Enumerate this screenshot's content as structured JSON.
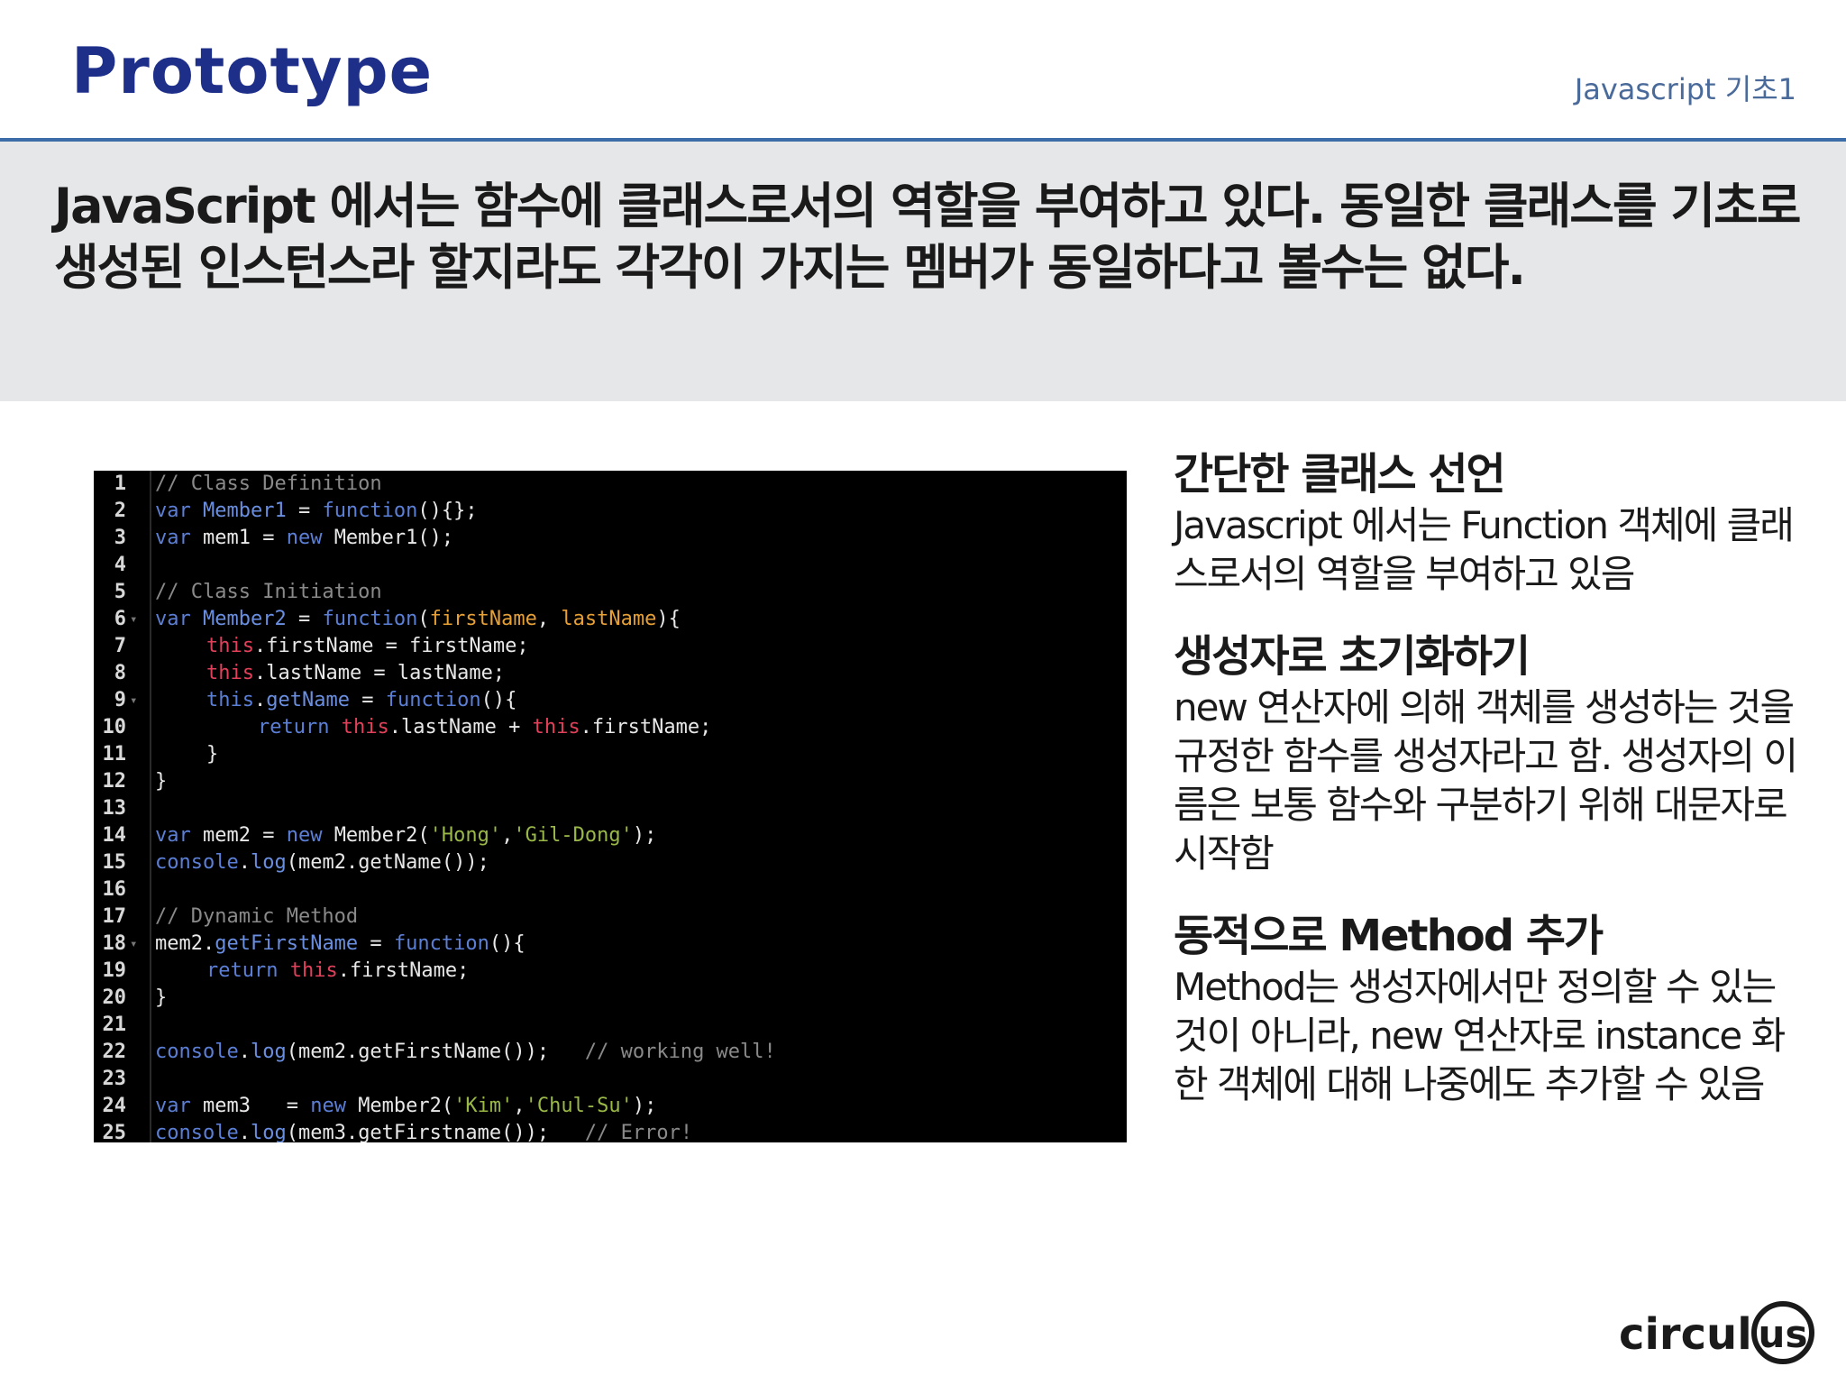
{
  "header": {
    "title": "Prototype",
    "tag": "Javascript 기초1"
  },
  "banner": {
    "text": "JavaScript 에서는 함수에 클래스로서의 역할을 부여하고 있다. 동일한 클래스를 기초로 생성된 인스턴스라 할지라도 각각이 가지는 멤버가 동일하다고 볼수는 없다."
  },
  "code": {
    "lines": [
      {
        "n": "1",
        "fold": "",
        "tokens": [
          [
            "cm",
            "// Class Definition"
          ]
        ]
      },
      {
        "n": "2",
        "fold": "",
        "tokens": [
          [
            "kw",
            "var "
          ],
          [
            "name",
            "Member1"
          ],
          [
            "plain",
            " = "
          ],
          [
            "fn",
            "function"
          ],
          [
            "plain",
            "(){};"
          ]
        ]
      },
      {
        "n": "3",
        "fold": "",
        "tokens": [
          [
            "kw",
            "var "
          ],
          [
            "plain",
            "mem1 = "
          ],
          [
            "kw",
            "new "
          ],
          [
            "plain",
            "Member1();"
          ]
        ]
      },
      {
        "n": "4",
        "fold": "",
        "tokens": []
      },
      {
        "n": "5",
        "fold": "",
        "tokens": [
          [
            "cm",
            "// Class Initiation"
          ]
        ]
      },
      {
        "n": "6",
        "fold": "▾",
        "tokens": [
          [
            "kw",
            "var "
          ],
          [
            "name",
            "Member2"
          ],
          [
            "plain",
            " = "
          ],
          [
            "fn",
            "function"
          ],
          [
            "plain",
            "("
          ],
          [
            "param",
            "firstName"
          ],
          [
            "plain",
            ", "
          ],
          [
            "param",
            "lastName"
          ],
          [
            "plain",
            "){"
          ]
        ]
      },
      {
        "n": "7",
        "fold": "",
        "indent": 1,
        "tokens": [
          [
            "this",
            "this"
          ],
          [
            "plain",
            ".firstName = firstName;"
          ]
        ]
      },
      {
        "n": "8",
        "fold": "",
        "indent": 1,
        "tokens": [
          [
            "this",
            "this"
          ],
          [
            "plain",
            ".lastName = lastName;"
          ]
        ]
      },
      {
        "n": "9",
        "fold": "▾",
        "indent": 1,
        "tokens": [
          [
            "kw",
            "this"
          ],
          [
            "plain",
            "."
          ],
          [
            "name",
            "getName"
          ],
          [
            "plain",
            " = "
          ],
          [
            "fn",
            "function"
          ],
          [
            "plain",
            "(){"
          ]
        ]
      },
      {
        "n": "10",
        "fold": "",
        "indent": 2,
        "tokens": [
          [
            "kw",
            "return "
          ],
          [
            "this",
            "this"
          ],
          [
            "plain",
            ".lastName + "
          ],
          [
            "this",
            "this"
          ],
          [
            "plain",
            ".firstName;"
          ]
        ]
      },
      {
        "n": "11",
        "fold": "",
        "indent": 1,
        "tokens": [
          [
            "plain",
            "}"
          ]
        ]
      },
      {
        "n": "12",
        "fold": "",
        "tokens": [
          [
            "plain",
            "}"
          ]
        ]
      },
      {
        "n": "13",
        "fold": "",
        "tokens": []
      },
      {
        "n": "14",
        "fold": "",
        "tokens": [
          [
            "kw",
            "var "
          ],
          [
            "plain",
            "mem2 = "
          ],
          [
            "kw",
            "new "
          ],
          [
            "plain",
            "Member2("
          ],
          [
            "str",
            "'Hong'"
          ],
          [
            "plain",
            ","
          ],
          [
            "str",
            "'Gil-Dong'"
          ],
          [
            "plain",
            ");"
          ]
        ]
      },
      {
        "n": "15",
        "fold": "",
        "tokens": [
          [
            "kw",
            "console"
          ],
          [
            "plain",
            "."
          ],
          [
            "name",
            "log"
          ],
          [
            "plain",
            "(mem2.getName());"
          ]
        ]
      },
      {
        "n": "16",
        "fold": "",
        "tokens": []
      },
      {
        "n": "17",
        "fold": "",
        "tokens": [
          [
            "cm",
            "// Dynamic Method"
          ]
        ]
      },
      {
        "n": "18",
        "fold": "▾",
        "tokens": [
          [
            "plain",
            "mem2."
          ],
          [
            "name",
            "getFirstName"
          ],
          [
            "plain",
            " = "
          ],
          [
            "fn",
            "function"
          ],
          [
            "plain",
            "(){"
          ]
        ]
      },
      {
        "n": "19",
        "fold": "",
        "indent": 1,
        "tokens": [
          [
            "kw",
            "return "
          ],
          [
            "this",
            "this"
          ],
          [
            "plain",
            ".firstName;"
          ]
        ]
      },
      {
        "n": "20",
        "fold": "",
        "tokens": [
          [
            "plain",
            "}"
          ]
        ]
      },
      {
        "n": "21",
        "fold": "",
        "tokens": []
      },
      {
        "n": "22",
        "fold": "",
        "tokens": [
          [
            "kw",
            "console"
          ],
          [
            "plain",
            "."
          ],
          [
            "name",
            "log"
          ],
          [
            "plain",
            "(mem2.getFirstName());   "
          ],
          [
            "cm",
            "// working well!"
          ]
        ]
      },
      {
        "n": "23",
        "fold": "",
        "tokens": []
      },
      {
        "n": "24",
        "fold": "",
        "tokens": [
          [
            "kw",
            "var "
          ],
          [
            "plain",
            "mem3   = "
          ],
          [
            "kw",
            "new "
          ],
          [
            "plain",
            "Member2("
          ],
          [
            "str",
            "'Kim'"
          ],
          [
            "plain",
            ","
          ],
          [
            "str",
            "'Chul-Su'"
          ],
          [
            "plain",
            ");"
          ]
        ]
      },
      {
        "n": "25",
        "fold": "",
        "tokens": [
          [
            "kw",
            "console"
          ],
          [
            "plain",
            "."
          ],
          [
            "name",
            "log"
          ],
          [
            "plain",
            "(mem3.getFirstname());   "
          ],
          [
            "cm",
            "// Error!"
          ]
        ]
      }
    ]
  },
  "sections": [
    {
      "heading": "간단한 클래스 선언",
      "body": "Javascript 에서는 Function 객체에 클래스로서의 역할을 부여하고 있음"
    },
    {
      "heading": "생성자로 초기화하기",
      "body": "new 연산자에 의해 객체를 생성하는 것을 규정한 함수를 생성자라고 함. 생성자의 이름은 보통 함수와 구분하기 위해 대문자로 시작함"
    },
    {
      "heading": "동적으로 Method 추가",
      "body": "Method는 생성자에서만 정의할 수 있는 것이 아니라, new 연산자로 instance 화 한 객체에 대해 나중에도 추가할 수 있음"
    }
  ],
  "logo": {
    "text": "circul",
    "circle_text": "us"
  }
}
